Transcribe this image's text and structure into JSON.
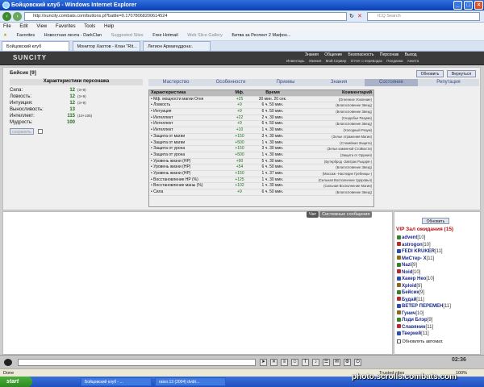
{
  "window": {
    "title": "Бойцовский клуб - Windows Internet Explorer"
  },
  "browser": {
    "url": "http://suncity.combats.com/buttons.pl?battle=0.17078068200614524",
    "search_placeholder": "ICQ Search",
    "menu": [
      "File",
      "Edit",
      "View",
      "Favorites",
      "Tools",
      "Help"
    ],
    "favorites_label": "Favorites",
    "bookmarks": [
      "Новостная лента - DarkClan",
      "Suggested Sites",
      "Free Hotmail",
      "Web Slice Gallery",
      "Битва за Респект 2 Мафон..."
    ],
    "tabs": [
      "Бойцовский клуб",
      "Монитор Хаотов - Клан \"Rit...",
      "Легион Армагеддона:."
    ],
    "status_left": "Done",
    "status_right": "Trusted sites",
    "zoom": "100%"
  },
  "game": {
    "logo": "SUNCITY",
    "top_links": [
      "Знания",
      "Общение",
      "Безопасность",
      "Персонаж",
      "Выход"
    ],
    "sub_links": [
      "Инвентарь",
      "Умения",
      "Мой Сервер",
      "Отчет о переводах",
      "Поединки",
      "Анкета"
    ],
    "character": {
      "name": "Бейсик",
      "level": "[9]"
    },
    "buttons": {
      "refresh": "Обновить",
      "back": "Вернуться",
      "apply": "сохранить"
    },
    "stats_title": "Характеристики персонажа",
    "stats": [
      {
        "label": "Сила:",
        "value": "12",
        "extra": "(3+9)"
      },
      {
        "label": "Ловкость:",
        "value": "12",
        "extra": "(3+9)"
      },
      {
        "label": "Интуиция:",
        "value": "12",
        "extra": "(3+9)"
      },
      {
        "label": "Выносливость:",
        "value": "13",
        "extra": ""
      },
      {
        "label": "Интеллект:",
        "value": "115",
        "extra": "(10+105)"
      },
      {
        "label": "Мудрость:",
        "value": "100",
        "extra": ""
      }
    ],
    "tabs": [
      "Мастерство",
      "Особенности",
      "Приемы",
      "Знания",
      "Состояние",
      "Репутация"
    ],
    "active_tab": "Состояние",
    "effects_headers": [
      "Характеристика",
      "Мф.",
      "Время",
      "Комментарий"
    ],
    "effects": [
      [
        "• Мф. мощности магии Огня",
        "+25",
        "30 мин. 20 сек.",
        "(Огненное Усиление)"
      ],
      [
        "• Ловкость",
        "+9",
        "6 ч. 50 мин.",
        "(Благословение Звезд)"
      ],
      [
        "• Интуиция",
        "+9",
        "6 ч. 50 мин.",
        "(Благословение Звезд)"
      ],
      [
        "• Интеллект",
        "+22",
        "2 ч. 30 мин.",
        "(Снадобье Разума)"
      ],
      [
        "• Интеллект",
        "+9",
        "6 ч. 50 мин.",
        "(Благословение Звезд)"
      ],
      [
        "• Интеллект",
        "+10",
        "1 ч. 30 мин.",
        "(Холодный Разум)"
      ],
      [
        "• Защита от магии",
        "+150",
        "3 ч. 30 мин.",
        "(Зелье отражения Магии)"
      ],
      [
        "• Защита от магии",
        "+500",
        "1 ч. 30 мин.",
        "(Стихийная Защита)"
      ],
      [
        "• Защита от урона",
        "+150",
        "3 ч. 30 мин.",
        "(Зелье каменной Стойкости)"
      ],
      [
        "• Защита от урона",
        "+500",
        "1 ч. 30 мин.",
        "(Защита от Оружия)"
      ],
      [
        "• Уровень жизни (HP)",
        "+90",
        "5 ч. 30 мин.",
        "(Бутерброд -Завтрак Рыцаря-)"
      ],
      [
        "• Уровень жизни (HP)",
        "+54",
        "6 ч. 50 мин.",
        "(Благословение Звезд)"
      ],
      [
        "• Уровень жизни (HP)",
        "+150",
        "1 ч. 37 мин.",
        "(Массаж -Наследие Гребницы-)"
      ],
      [
        "• Восстановление HP (%)",
        "+125",
        "1 ч. 30 мин.",
        "(Сильная Восполнение Здоровья)"
      ],
      [
        "• Восстановление маны (%)",
        "+102",
        "1 ч. 30 мин.",
        "(Сильная Восполнение Магии)"
      ],
      [
        "• Сила",
        "+9",
        "6 ч. 50 мин.",
        "(Благословение Звезд)"
      ]
    ],
    "chat_tabs": [
      "Чат",
      "Системные сообщения"
    ],
    "room": {
      "refresh": "Обновить",
      "title": "VIP Зал ожидания (15)",
      "users": [
        {
          "name": "advent",
          "level": "[10]"
        },
        {
          "name": "astrogon",
          "level": "[10]"
        },
        {
          "name": "FEDI KRUKER",
          "level": "[11]"
        },
        {
          "name": "МиСтер- X",
          "level": "[11]"
        },
        {
          "name": "Nazi",
          "level": "[9]"
        },
        {
          "name": "Noid",
          "level": "[10]"
        },
        {
          "name": "Хакер Нео",
          "level": "[10]"
        },
        {
          "name": "Xploid",
          "level": "[9]"
        },
        {
          "name": "Бейсик",
          "level": "[9]"
        },
        {
          "name": "Будай",
          "level": "[11]"
        },
        {
          "name": "ВЕТЕР ПЕРЕМЕН",
          "level": "[11]"
        },
        {
          "name": "Гунич",
          "level": "[10]"
        },
        {
          "name": "Лэди Блэр",
          "level": "[9]"
        },
        {
          "name": "Славянин",
          "level": "[11]"
        },
        {
          "name": "Тверкей",
          "level": "[11]"
        }
      ],
      "auto_refresh": "Обновлять автомат."
    },
    "clock": "02:36"
  },
  "taskbar": {
    "start": "start",
    "tasks": [
      "Бойцовский клуб - ...",
      "raion.13 (2004) dvdri..."
    ]
  },
  "watermark": "photo.scrolls.combats.com"
}
